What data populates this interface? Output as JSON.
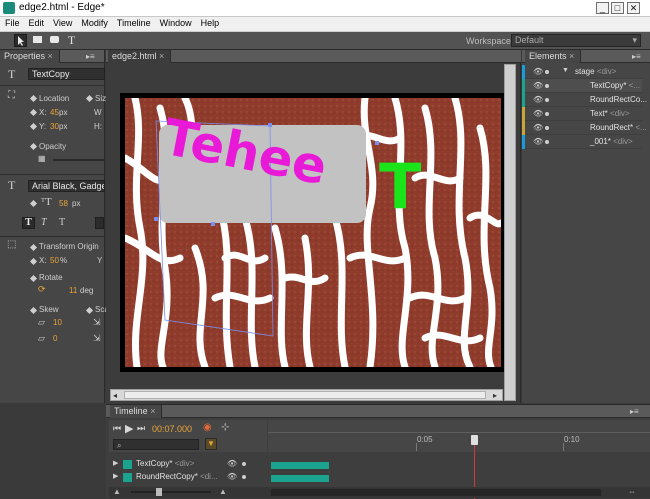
{
  "window": {
    "title": "edge2.html - Edge*",
    "min": "_",
    "max": "□",
    "close": "✕"
  },
  "menu": [
    "File",
    "Edit",
    "View",
    "Modify",
    "Timeline",
    "Window",
    "Help"
  ],
  "toolbar": {
    "workspace_label": "Workspace:",
    "workspace_value": "Default",
    "tools": [
      "select-tool",
      "rectangle-tool",
      "rounded-rect-tool",
      "text-tool"
    ]
  },
  "properties": {
    "tab": "Properties",
    "element_name": "TextCopy",
    "location_label": "Location",
    "size_label": "Siz",
    "x_label": "X:",
    "x_value": "45",
    "x_unit": "px",
    "w_label": "W",
    "y_label": "Y:",
    "y_value": "30",
    "y_unit": "px",
    "h_label": "H:",
    "opacity_label": "Opacity",
    "font_value": "Arial Black, Gadget, s",
    "font_size": "58",
    "font_unit": "px",
    "transform_origin_label": "Transform Origin",
    "origin_x_label": "X:",
    "origin_x_value": "50",
    "origin_x_unit": "%",
    "origin_y_label": "Y",
    "rotate_label": "Rotate",
    "rotate_value": "11",
    "rotate_unit": "deg",
    "skew_label": "Skew",
    "scale_label": "Sca",
    "skew_value": "10",
    "skew2_value": "0",
    "bold_glyph": "T",
    "italic_glyph": "T",
    "text_glyph": "T"
  },
  "document": {
    "tab": "edge2.html",
    "close": "×"
  },
  "stage": {
    "text1": "Tehee",
    "text2": "T",
    "text1_color": "#e81ad7",
    "text2_color": "#1be41b",
    "bg_color": "#8f3c2c",
    "box_color": "#c2c2c2"
  },
  "elements": {
    "tab": "Elements",
    "rows": [
      {
        "name": "stage",
        "suffix": "<div>",
        "color": "#1a9ad8"
      },
      {
        "name": "TextCopy*",
        "suffix": "<...",
        "color": "#1aa38f"
      },
      {
        "name": "RoundRectCo...",
        "suffix": "",
        "color": "#1aa38f"
      },
      {
        "name": "Text*",
        "suffix": "<div>",
        "color": "#c9a43a"
      },
      {
        "name": "RoundRect*",
        "suffix": "<...",
        "color": "#c9a43a"
      },
      {
        "name": "_001*",
        "suffix": "<div>",
        "color": "#1a9ad8"
      }
    ]
  },
  "timeline": {
    "tab": "Timeline",
    "time": "00:07.000",
    "marks": [
      "0:05",
      "0:10"
    ],
    "rows": [
      {
        "name": "TextCopy*",
        "suffix": "<div>"
      },
      {
        "name": "RoundRectCopy*",
        "suffix": "<di..."
      }
    ]
  }
}
